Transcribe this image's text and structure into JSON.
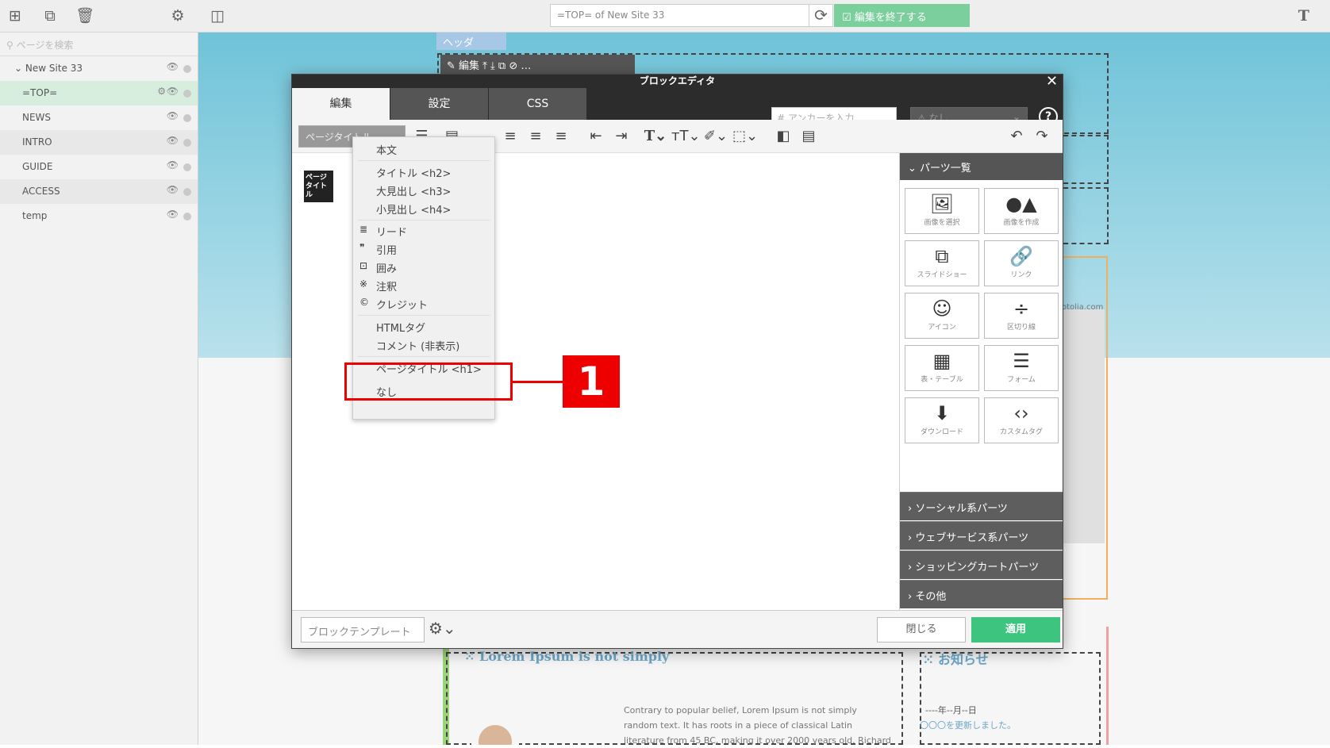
{
  "topbar": {
    "url": "=TOP= of New Site 33",
    "finish_label": "編集を終了する"
  },
  "sidebar": {
    "search_placeholder": "ページを検索",
    "site_name": "New Site 33",
    "pages": [
      {
        "label": "=TOP="
      },
      {
        "label": "NEWS"
      },
      {
        "label": "INTRO"
      },
      {
        "label": "GUIDE"
      },
      {
        "label": "ACCESS"
      },
      {
        "label": "temp"
      }
    ]
  },
  "background": {
    "header_tag": "ヘッダ",
    "edit_label": "編集",
    "lorem_heading": "Lorem Ipsum is not simply",
    "news_heading": "お知らせ",
    "lorem_body": [
      "Contrary to popular belief, Lorem Ipsum is not simply",
      "random text. It has roots in a piece of classical Latin",
      "literature from 45 BC, making it over 2000 years old. Richard"
    ],
    "news_date": "----年--月--日",
    "news_text": "〇〇〇を更新しました。",
    "watermark": "otolia.com"
  },
  "modal": {
    "title": "ブロックエディタ",
    "tabs": [
      {
        "label": "編集"
      },
      {
        "label": "設定"
      },
      {
        "label": "CSS"
      }
    ],
    "anchor_placeholder": "アンカーを入力",
    "anchor_select": "なし",
    "format_select": "ページタイトル",
    "page_title_badge": "ページタイトル",
    "parts_header": "パーツ一覧",
    "parts": [
      {
        "icon": "image-icon",
        "label": "画像を選択"
      },
      {
        "icon": "shapes-icon",
        "label": "画像を作成"
      },
      {
        "icon": "slideshow-icon",
        "label": "スライドショー"
      },
      {
        "icon": "link-icon",
        "label": "リンク"
      },
      {
        "icon": "smiley-icon",
        "label": "アイコン"
      },
      {
        "icon": "divider-icon",
        "label": "区切り線"
      },
      {
        "icon": "table-icon",
        "label": "表・テーブル"
      },
      {
        "icon": "form-icon",
        "label": "フォーム"
      },
      {
        "icon": "download-icon",
        "label": "ダウンロード"
      },
      {
        "icon": "code-icon",
        "label": "カスタムタグ"
      }
    ],
    "accordions": [
      {
        "label": "ソーシャル系パーツ"
      },
      {
        "label": "ウェブサービス系パーツ"
      },
      {
        "label": "ショッピングカートパーツ"
      },
      {
        "label": "その他"
      }
    ],
    "footer": {
      "template_label": "ブロックテンプレート",
      "close_label": "閉じる",
      "apply_label": "適用"
    }
  },
  "dropdown": {
    "items": [
      {
        "label": "本文",
        "icon": ""
      },
      {
        "label": "タイトル <h2>",
        "icon": ""
      },
      {
        "label": "大見出し <h3>",
        "icon": ""
      },
      {
        "label": "小見出し <h4>",
        "icon": ""
      },
      {
        "label": "リード",
        "icon": "≣"
      },
      {
        "label": "引用",
        "icon": "❞"
      },
      {
        "label": "囲み",
        "icon": "⊡"
      },
      {
        "label": "注釈",
        "icon": "※"
      },
      {
        "label": "クレジット",
        "icon": "©"
      },
      {
        "label": "HTMLタグ",
        "icon": ""
      },
      {
        "label": "コメント (非表示)",
        "icon": ""
      },
      {
        "label": "ページタイトル <h1>",
        "icon": ""
      },
      {
        "label": "なし",
        "icon": ""
      }
    ]
  },
  "annotation": {
    "number": "1",
    "color": "#e00000"
  },
  "colors": {
    "accent": "#3dc47e",
    "dark": "#2c2c2c"
  }
}
